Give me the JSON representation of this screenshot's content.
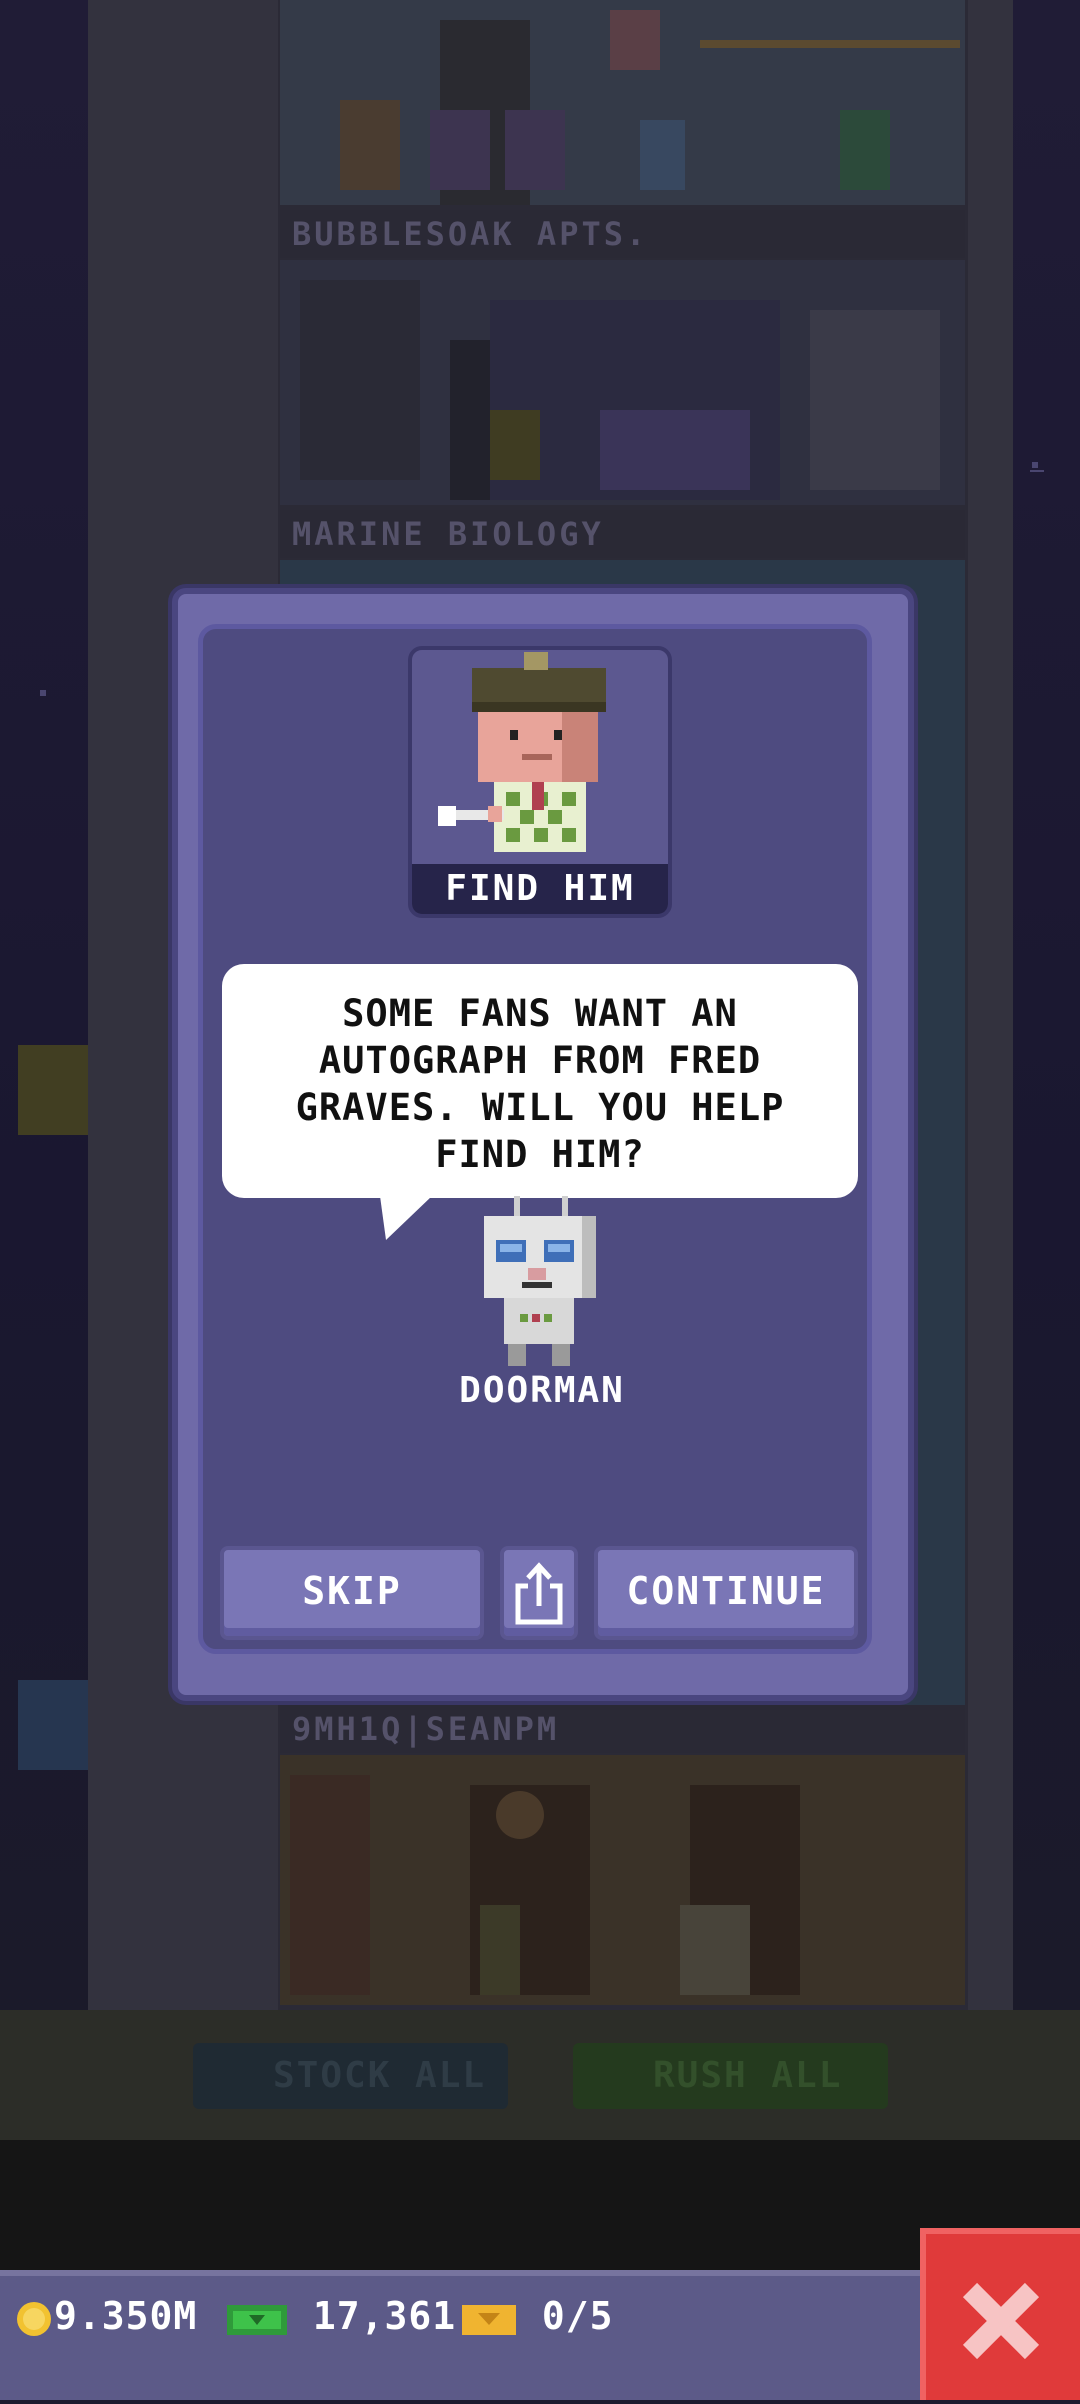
{
  "background": {
    "floors": [
      {
        "name": "BUBBLESOAK APTS."
      },
      {
        "name": "MARINE BIOLOGY"
      },
      {
        "name": "9MH1Q|SEANPM"
      }
    ],
    "bottom_buttons": {
      "stock_all": "STOCK ALL",
      "rush_all": "RUSH ALL"
    }
  },
  "dialog": {
    "portrait_label": "FIND HIM",
    "message": "SOME FANS WANT AN AUTOGRAPH FROM FRED GRAVES. WILL YOU HELP FIND HIM?",
    "speaker": "DOORMAN",
    "buttons": {
      "skip": "SKIP",
      "continue": "CONTINUE"
    },
    "share_icon": "share-icon"
  },
  "status": {
    "coins": "9.350M",
    "bux": "17,361",
    "tickets": "0/5"
  },
  "colors": {
    "close_button": "#e03a3a",
    "dialog_panel": "#4e4b80",
    "button": "#7a76b6"
  }
}
